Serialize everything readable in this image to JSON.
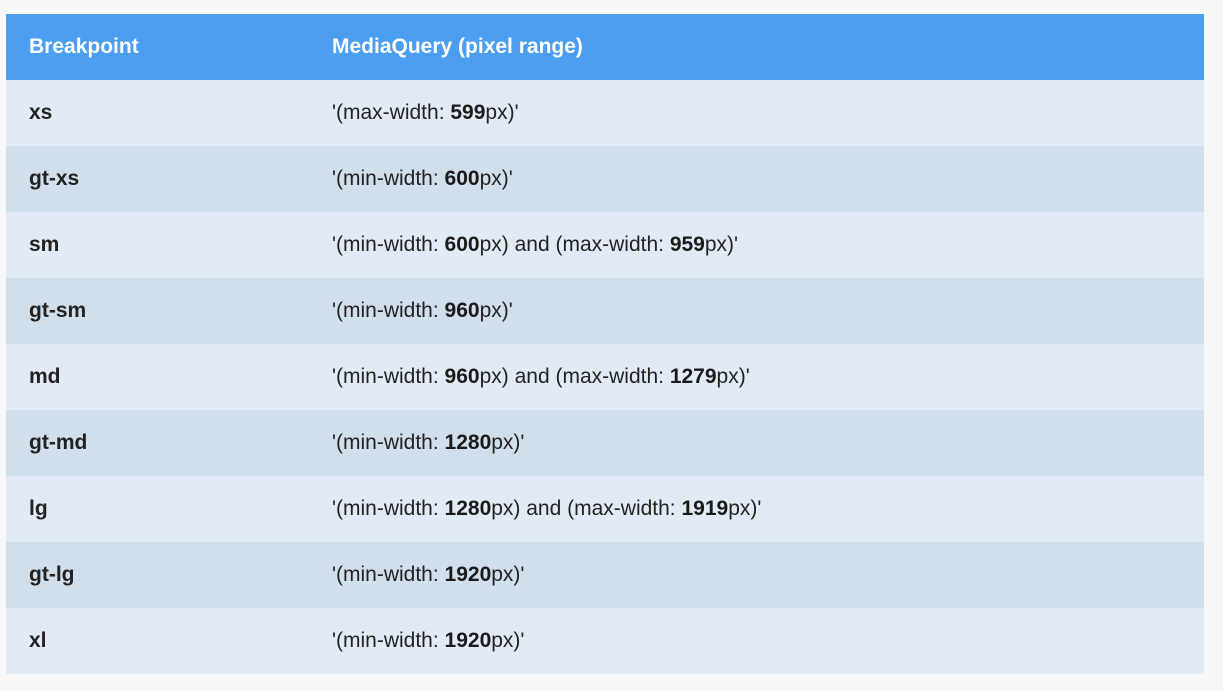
{
  "header": {
    "breakpoint": "Breakpoint",
    "mediaquery": "MediaQuery (pixel range)"
  },
  "rows": [
    {
      "bp": "xs",
      "mq": [
        {
          "t": "'(max-width: "
        },
        {
          "t": "599",
          "b": true
        },
        {
          "t": "px)'"
        }
      ]
    },
    {
      "bp": "gt-xs",
      "mq": [
        {
          "t": "'(min-width: "
        },
        {
          "t": "600",
          "b": true
        },
        {
          "t": "px)'"
        }
      ]
    },
    {
      "bp": "sm",
      "mq": [
        {
          "t": "'(min-width: "
        },
        {
          "t": "600",
          "b": true
        },
        {
          "t": "px) and (max-width: "
        },
        {
          "t": "959",
          "b": true
        },
        {
          "t": "px)'"
        }
      ]
    },
    {
      "bp": "gt-sm",
      "mq": [
        {
          "t": "'(min-width: "
        },
        {
          "t": "960",
          "b": true
        },
        {
          "t": "px)'"
        }
      ]
    },
    {
      "bp": "md",
      "mq": [
        {
          "t": "'(min-width: "
        },
        {
          "t": "960",
          "b": true
        },
        {
          "t": "px) and (max-width: "
        },
        {
          "t": "1279",
          "b": true
        },
        {
          "t": "px)'"
        }
      ]
    },
    {
      "bp": "gt-md",
      "mq": [
        {
          "t": "'(min-width: "
        },
        {
          "t": "1280",
          "b": true
        },
        {
          "t": "px)'"
        }
      ]
    },
    {
      "bp": "lg",
      "mq": [
        {
          "t": "'(min-width: "
        },
        {
          "t": "1280",
          "b": true
        },
        {
          "t": "px) and (max-width: "
        },
        {
          "t": "1919",
          "b": true
        },
        {
          "t": "px)'"
        }
      ]
    },
    {
      "bp": "gt-lg",
      "mq": [
        {
          "t": "'(min-width: "
        },
        {
          "t": "1920",
          "b": true
        },
        {
          "t": "px)'"
        }
      ]
    },
    {
      "bp": "xl",
      "mq": [
        {
          "t": "'(min-width: "
        },
        {
          "t": "1920",
          "b": true
        },
        {
          "t": "px)'"
        }
      ]
    }
  ],
  "colors": {
    "header_bg": "#4c9ef0",
    "row_light": "#e2ebf5",
    "row_dark": "#d1deeb"
  }
}
